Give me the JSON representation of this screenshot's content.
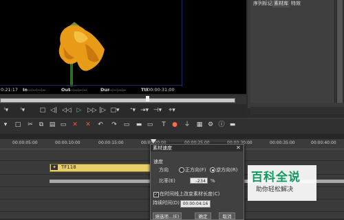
{
  "timecodes": {
    "current": "0:21:17",
    "in_label": "In",
    "in_value": "--:--:--:--",
    "out_label": "Out",
    "out_value": "--:--:--:--",
    "dur_label": "Dur",
    "dur_value": "--:--:--:--",
    "ttl_label": "Ttl",
    "ttl_value": "00:00:31:00"
  },
  "right_panel": {
    "tabs": [
      "序列标记",
      "素材库",
      "特效"
    ],
    "active_tab": 1
  },
  "transport": {
    "buttons": [
      "in-mark",
      "out-mark",
      "stop",
      "step-back",
      "rewind",
      "play",
      "fast-forward",
      "step-forward",
      "loop",
      "insert",
      "overwrite",
      "split",
      "more"
    ]
  },
  "ruler": {
    "ticks": [
      "00:00:05:00",
      "00:00:10:00",
      "00:00:15:00",
      "00:00:20:00",
      "00:00:25:00",
      "00:00:30:00",
      "00:00:35:00",
      "00:00:40:00"
    ]
  },
  "clip": {
    "label": "TF118"
  },
  "dialog": {
    "title": "素材速度",
    "section": "速度",
    "direction_label": "方向",
    "forward_label": "正方向(F)",
    "reverse_label": "逆方向(R)",
    "selected_direction": "reverse",
    "ratio_label": "比率(E)",
    "ratio_value": "-234",
    "ratio_unit": "%",
    "checkbox_label": "在时间线上改变素材长度(C)",
    "checkbox_checked": true,
    "duration_label": "持续时间(D)",
    "duration_value": "00:00:04:16",
    "button_options": "熔选项...(E)",
    "button_ok": "确定",
    "button_cancel": "取消"
  },
  "watermark": {
    "logo": "百科全说",
    "subtitle": "助你轻松解决"
  }
}
